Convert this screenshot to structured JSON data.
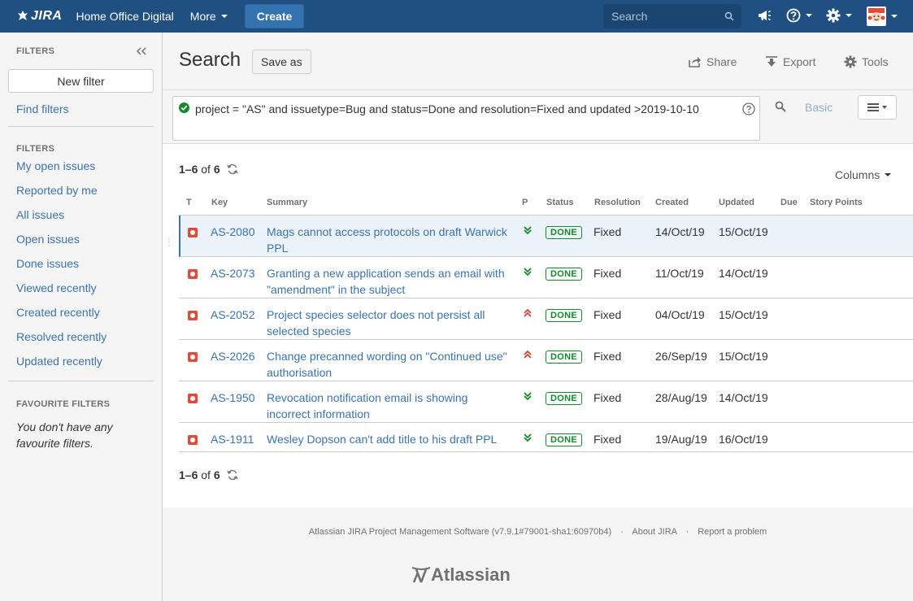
{
  "topbar": {
    "logo_text": "JIRA",
    "project_link": "Home Office Digital",
    "more_label": "More",
    "create_label": "Create",
    "search_placeholder": "Search"
  },
  "sidebar": {
    "heading": "FILTERS",
    "new_filter_label": "New filter",
    "find_filters_label": "Find filters",
    "filters_heading": "FILTERS",
    "filters": [
      "My open issues",
      "Reported by me",
      "All issues",
      "Open issues",
      "Done issues",
      "Viewed recently",
      "Created recently",
      "Resolved recently",
      "Updated recently"
    ],
    "favourites_heading": "FAVOURITE FILTERS",
    "favourites_empty": "You don't have any favourite filters."
  },
  "header": {
    "title": "Search",
    "save_as_label": "Save as",
    "share_label": "Share",
    "export_label": "Export",
    "tools_label": "Tools"
  },
  "query": {
    "jql": "project = \"AS\" and issuetype=Bug and status=Done and resolution=Fixed and updated >2019-10-10",
    "basic_label": "Basic"
  },
  "results": {
    "range": "1–6",
    "of_label": "of",
    "total": "6",
    "columns_label": "Columns",
    "headers": {
      "t": "T",
      "key": "Key",
      "summary": "Summary",
      "p": "P",
      "status": "Status",
      "resolution": "Resolution",
      "created": "Created",
      "updated": "Updated",
      "due": "Due",
      "story_points": "Story Points"
    },
    "rows": [
      {
        "key": "AS-2080",
        "summary": "Mags cannot access protocols on draft Warwick PPL",
        "priority": "low",
        "status": "DONE",
        "resolution": "Fixed",
        "created": "14/Oct/19",
        "updated": "15/Oct/19"
      },
      {
        "key": "AS-2073",
        "summary": "Granting a new application sends an email with \"amendment\" in the subject",
        "priority": "low",
        "status": "DONE",
        "resolution": "Fixed",
        "created": "11/Oct/19",
        "updated": "14/Oct/19"
      },
      {
        "key": "AS-2052",
        "summary": "Project species selector does not persist all selected species",
        "priority": "high",
        "status": "DONE",
        "resolution": "Fixed",
        "created": "04/Oct/19",
        "updated": "15/Oct/19"
      },
      {
        "key": "AS-2026",
        "summary": "Change precanned wording on \"Continued use\" authorisation",
        "priority": "high",
        "status": "DONE",
        "resolution": "Fixed",
        "created": "26/Sep/19",
        "updated": "15/Oct/19"
      },
      {
        "key": "AS-1950",
        "summary": "Revocation notification email is showing incorrect information",
        "priority": "low",
        "status": "DONE",
        "resolution": "Fixed",
        "created": "28/Aug/19",
        "updated": "14/Oct/19"
      },
      {
        "key": "AS-1911",
        "summary": "Wesley Dopson can't add title to his draft PPL",
        "priority": "low",
        "status": "DONE",
        "resolution": "Fixed",
        "created": "19/Aug/19",
        "updated": "16/Oct/19"
      }
    ]
  },
  "footer": {
    "software": "Atlassian JIRA Project Management Software (v7.9.1#79001-sha1:60970b4)",
    "separator": "·",
    "about": "About JIRA",
    "report": "Report a problem",
    "brand": "Atlassian"
  },
  "colors": {
    "topbar": "#205081",
    "link": "#3b73af",
    "done": "#14892c",
    "bug": "#e5493a"
  }
}
